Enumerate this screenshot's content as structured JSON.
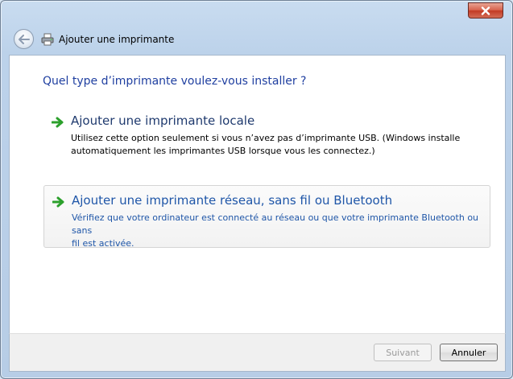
{
  "window": {
    "title": "Ajouter une imprimante",
    "close_icon": "close-icon"
  },
  "nav": {
    "back_icon": "back-arrow-icon",
    "printer_icon": "printer-icon"
  },
  "content": {
    "heading": "Quel type d’imprimante voulez-vous installer ?",
    "options": [
      {
        "title": "Ajouter une imprimante locale",
        "desc_line1": "Utilisez cette option seulement si vous n’avez pas d’imprimante USB. (Windows installe",
        "desc_line2": "automatiquement les imprimantes USB lorsque vous les connectez.)",
        "icon": "green-arrow-icon"
      },
      {
        "title": "Ajouter une imprimante réseau, sans fil ou Bluetooth",
        "desc_line1": "Vérifiez que votre ordinateur est connecté au réseau ou que votre imprimante Bluetooth ou sans",
        "desc_line2": "fil est activée.",
        "icon": "green-arrow-icon",
        "hovered": true
      }
    ]
  },
  "footer": {
    "next_label": "Suivant",
    "next_enabled": false,
    "cancel_label": "Annuler"
  },
  "colors": {
    "heading": "#1f3fa0",
    "link_hover": "#1f56a8",
    "arrow_green": "#2ca02c"
  }
}
